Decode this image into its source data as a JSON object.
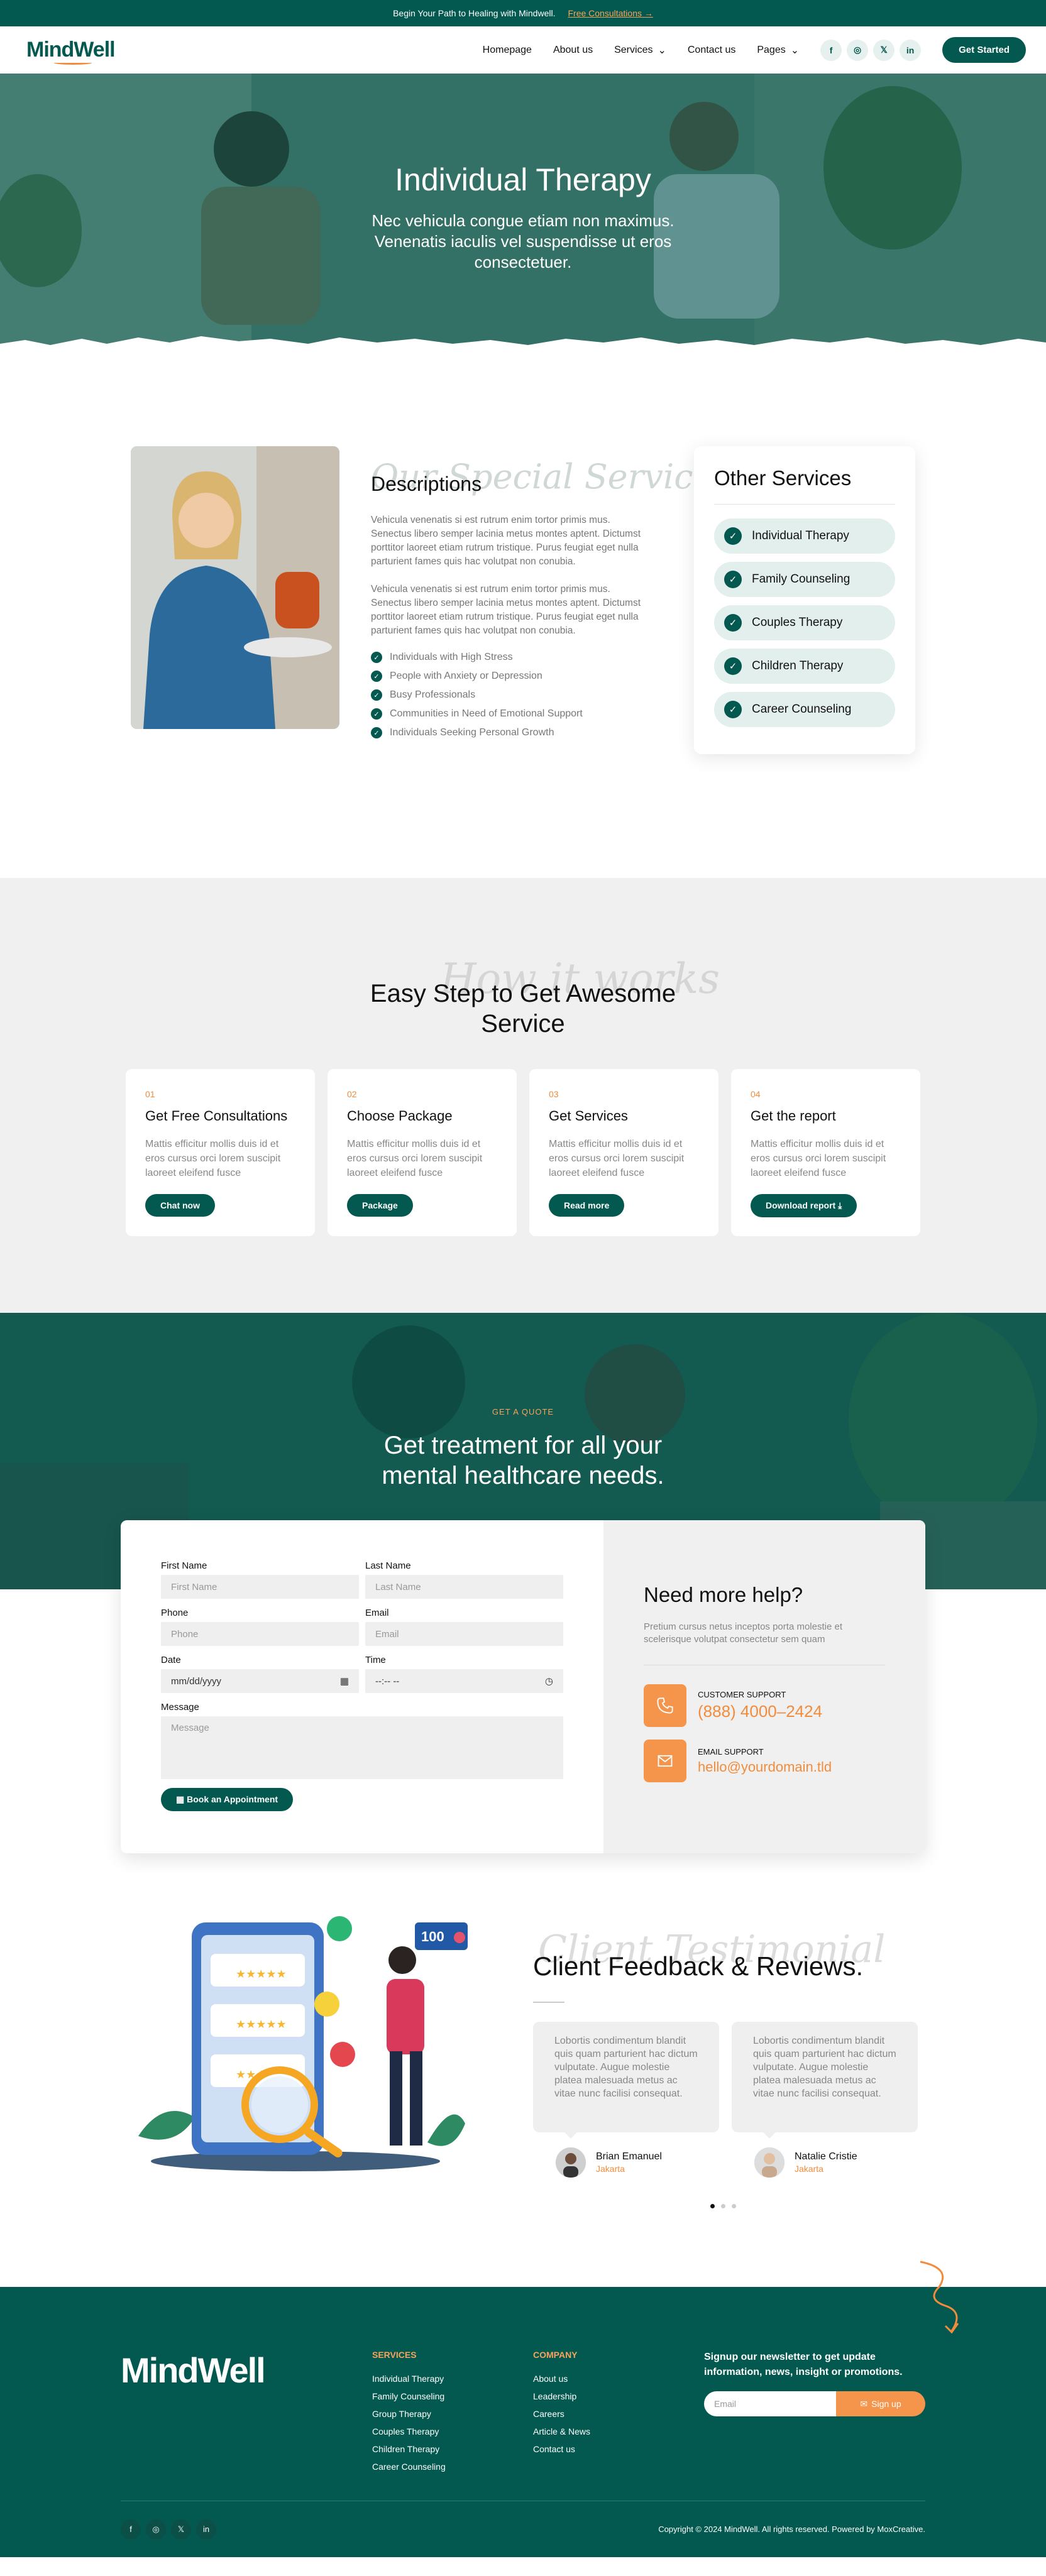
{
  "topbar": {
    "text": "Begin Your Path to Healing with Mindwell.",
    "link": "Free Consultations"
  },
  "nav": {
    "logo": "MindWell",
    "links": [
      "Homepage",
      "About us",
      "Services",
      "Contact us",
      "Pages"
    ],
    "socials": [
      "f",
      "ig",
      "tw",
      "in"
    ],
    "cta": "Get Started"
  },
  "hero": {
    "title": "Individual Therapy",
    "subtitle": "Nec vehicula congue etiam non maximus. Venenatis iaculis vel suspendisse ut eros consectetuer."
  },
  "description": {
    "script": "Our Special Services",
    "heading": "Descriptions",
    "para1": "Vehicula venenatis si est rutrum enim tortor primis mus. Senectus libero semper lacinia metus montes aptent. Dictumst porttitor laoreet etiam rutrum tristique. Purus feugiat eget nulla parturient fames quis hac volutpat non conubia.",
    "para2": "Vehicula venenatis si est rutrum enim tortor primis mus. Senectus libero semper lacinia metus montes aptent. Dictumst porttitor laoreet etiam rutrum tristique. Purus feugiat eget nulla parturient fames quis hac volutpat non conubia.",
    "list": [
      "Individuals with High Stress",
      "People with Anxiety or Depression",
      "Busy Professionals",
      "Communities in Need of Emotional Support",
      "Individuals Seeking Personal Growth"
    ]
  },
  "other_services": {
    "title": "Other Services",
    "items": [
      "Individual Therapy",
      "Family Counseling",
      "Couples Therapy",
      "Children Therapy",
      "Career Counseling"
    ]
  },
  "steps": {
    "script": "How it works",
    "title": "Easy Step to Get Awesome Service",
    "items": [
      {
        "num": "01",
        "title": "Get Free Consultations",
        "text": "Mattis efficitur mollis duis id et eros cursus orci lorem suscipit laoreet eleifend fusce",
        "btn": "Chat now"
      },
      {
        "num": "02",
        "title": "Choose Package",
        "text": "Mattis efficitur mollis duis id et eros cursus orci lorem suscipit laoreet eleifend fusce",
        "btn": "Package"
      },
      {
        "num": "03",
        "title": "Get Services",
        "text": "Mattis efficitur mollis duis id et eros cursus orci lorem suscipit laoreet eleifend fusce",
        "btn": "Read more"
      },
      {
        "num": "04",
        "title": "Get the report",
        "text": "Mattis efficitur mollis duis id et eros cursus orci lorem suscipit laoreet eleifend fusce",
        "btn": "Download report"
      }
    ]
  },
  "quote": {
    "tag": "GET A QUOTE",
    "title": "Get treatment for all your mental healthcare needs.",
    "form": {
      "first_label": "First Name",
      "first_ph": "First Name",
      "last_label": "Last Name",
      "last_ph": "Last Name",
      "phone_label": "Phone",
      "phone_ph": "Phone",
      "email_label": "Email",
      "email_ph": "Email",
      "date_label": "Date",
      "date_val": "mm/dd/yyyy",
      "time_label": "Time",
      "time_val": "--:-- --",
      "msg_label": "Message",
      "msg_ph": "Message",
      "submit": "Book an Appointment"
    },
    "help": {
      "title": "Need more help?",
      "text": "Pretium cursus netus inceptos porta molestie et scelerisque volutpat consectetur sem quam",
      "support_label": "CUSTOMER SUPPORT",
      "support_val": "(888) 4000–2424",
      "email_label": "EMAIL SUPPORT",
      "email_val": "hello@yourdomain.tld"
    }
  },
  "testimonials": {
    "script": "Client Testimonial",
    "title": "Client Feedback & Reviews.",
    "badge": "100",
    "items": [
      {
        "text": "Lobortis condimentum blandit quis quam parturient hac dictum vulputate. Augue molestie platea malesuada metus ac vitae nunc facilisi consequat.",
        "name": "Brian Emanuel",
        "role": "Jakarta"
      },
      {
        "text": "Lobortis condimentum blandit quis quam parturient hac dictum vulputate. Augue molestie platea malesuada metus ac vitae nunc facilisi consequat.",
        "name": "Natalie Cristie",
        "role": "Jakarta"
      }
    ]
  },
  "footer": {
    "logo": "MindWell",
    "services_title": "SERVICES",
    "services": [
      "Individual Therapy",
      "Family Counseling",
      "Group Therapy",
      "Couples Therapy",
      "Children Therapy",
      "Career Counseling"
    ],
    "company_title": "COMPANY",
    "company": [
      "About us",
      "Leadership",
      "Careers",
      "Article & News",
      "Contact us"
    ],
    "news_title": "Signup our newsletter to get update information, news, insight or promotions.",
    "email_ph": "Email",
    "signup": "Sign up",
    "socials": [
      "f",
      "ig",
      "X",
      "in"
    ],
    "copyright": "Copyright © 2024 MindWell. All rights reserved. Powered by MoxCreative."
  },
  "colors": {
    "primary": "#03594f",
    "accent": "#f28c3c",
    "light": "#e3efec"
  }
}
